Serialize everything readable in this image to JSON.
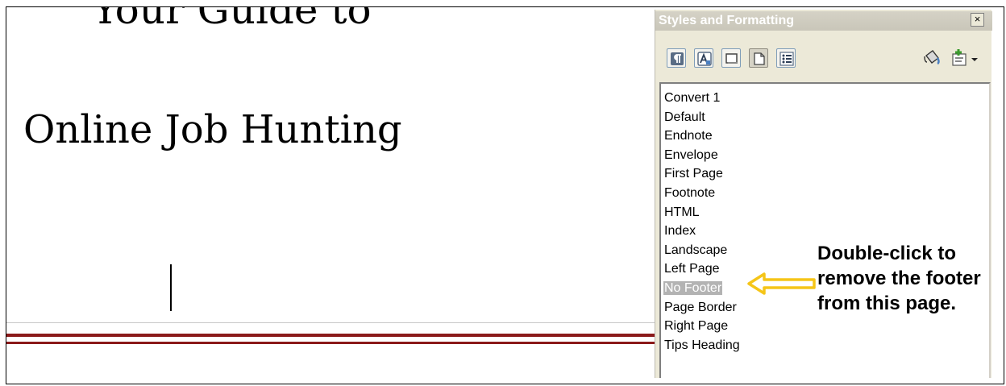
{
  "document": {
    "heading_top": "Your Guide to",
    "heading_main": "Online Job Hunting",
    "rule_color": "#8b1a1a"
  },
  "panel": {
    "title": "Styles and Formatting",
    "close_glyph": "×",
    "toolbar": [
      {
        "name": "paragraph-styles",
        "icon": "paragraph-icon"
      },
      {
        "name": "character-styles",
        "icon": "character-icon"
      },
      {
        "name": "frame-styles",
        "icon": "frame-icon"
      },
      {
        "name": "page-styles",
        "icon": "page-icon",
        "active": true
      },
      {
        "name": "list-styles",
        "icon": "list-icon"
      }
    ],
    "actions": [
      {
        "name": "fill-format-mode",
        "icon": "paint-bucket-icon"
      },
      {
        "name": "new-style-from-selection",
        "icon": "new-style-icon"
      }
    ],
    "styles": [
      "Convert 1",
      "Default",
      "Endnote",
      "Envelope",
      "First Page",
      "Footnote",
      "HTML",
      "Index",
      "Landscape",
      "Left Page",
      "No Footer",
      "Page Border",
      "Right Page",
      "Tips Heading"
    ],
    "selected_style": "No Footer",
    "selection_color": "#b3b3b3"
  },
  "annotation": {
    "text": "Double-click to remove the footer from this page.",
    "arrow_color": "#f5c518"
  }
}
